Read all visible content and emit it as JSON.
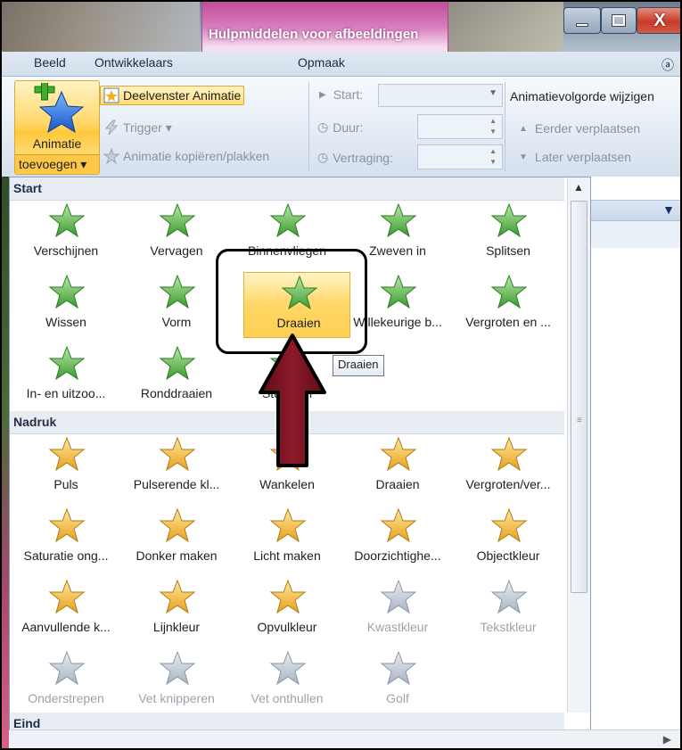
{
  "window": {
    "context_title": "Hulpmiddelen voor afbeeldingen",
    "min_glyph": "",
    "max_glyph": "",
    "close_glyph": "X"
  },
  "tabs": {
    "beeld": "Beeld",
    "ontwikkelaars": "Ontwikkelaars",
    "opmaak": "Opmaak",
    "chevron": "ⓐ"
  },
  "ribbon": {
    "add_animation_line1": "Animatie",
    "add_animation_line2": "toevoegen ▾",
    "animation_pane": "Deelvenster Animatie",
    "trigger": "Trigger ▾",
    "copy_animation": "Animatie kopiëren/plakken",
    "start_label": "Start:",
    "duration_label": "Duur:",
    "delay_label": "Vertraging:",
    "reorder_title": "Animatievolgorde wijzigen",
    "move_earlier": "Eerder verplaatsen",
    "move_later": "Later verplaatsen"
  },
  "gallery": {
    "sections": {
      "start": "Start",
      "nadruk": "Nadruk",
      "eind": "Eind"
    },
    "start_items": [
      "Verschijnen",
      "Vervagen",
      "Binnenvliegen",
      "Zweven in",
      "Splitsen",
      "Wissen",
      "Vorm",
      "Draaien",
      "Willekeurige b...",
      "Vergroten en ...",
      "In- en uitzoo...",
      "Ronddraaien",
      "Stuiteren"
    ],
    "nadruk_items": [
      "Puls",
      "Pulserende kl...",
      "Wankelen",
      "Draaien",
      "Vergroten/ver...",
      "Saturatie ong...",
      "Donker maken",
      "Licht maken",
      "Doorzichtighe...",
      "Objectkleur",
      "Aanvullende k...",
      "Lijnkleur",
      "Opvulkleur",
      "Kwastkleur",
      "Tekstkleur",
      "Onderstrepen",
      "Vet knipperen",
      "Vet onthullen",
      "Golf"
    ],
    "tooltip": "Draaien"
  },
  "colors": {
    "accent_pink": "#c04d98",
    "selected_gold": "#ffd767",
    "green_star": "#4caa3c",
    "gold_star": "#f0b030",
    "arrow_red": "#7a1020"
  }
}
